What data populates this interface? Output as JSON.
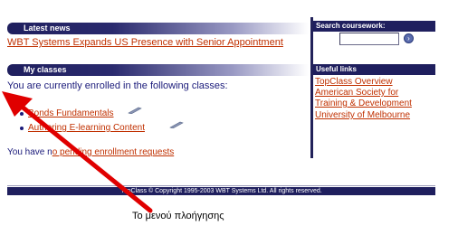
{
  "latest_news": {
    "header": "Latest news",
    "item": "WBT Systems Expands US Presence with Senior Appointment"
  },
  "my_classes": {
    "header": "My classes",
    "intro": "You are currently enrolled in the following classes:",
    "classes": [
      {
        "label": "Bonds Fundamentals"
      },
      {
        "label": "Authoring E-learning Content"
      }
    ],
    "pending_prefix": "You have n",
    "pending_link": "o pending enrollment requests"
  },
  "search": {
    "header": "Search coursework:",
    "value": "",
    "go_icon": "arrow-right-icon"
  },
  "useful_links": {
    "header": "Useful links",
    "items": [
      {
        "label": "TopClass Overview"
      },
      {
        "label": "American Society for"
      },
      {
        "label": "Training & Development"
      },
      {
        "label": "University of Melbourne"
      }
    ]
  },
  "footer": {
    "text": "TopClass © Copyright 1995-2003 WBT Systems Ltd. All rights reserved."
  },
  "annotation": {
    "caption": "Το μενού πλοήγησης",
    "arrow_color": "#e00000"
  },
  "colors": {
    "header_bg": "#1f1f5e",
    "link": "#c03000",
    "text": "#1a1a7a"
  }
}
